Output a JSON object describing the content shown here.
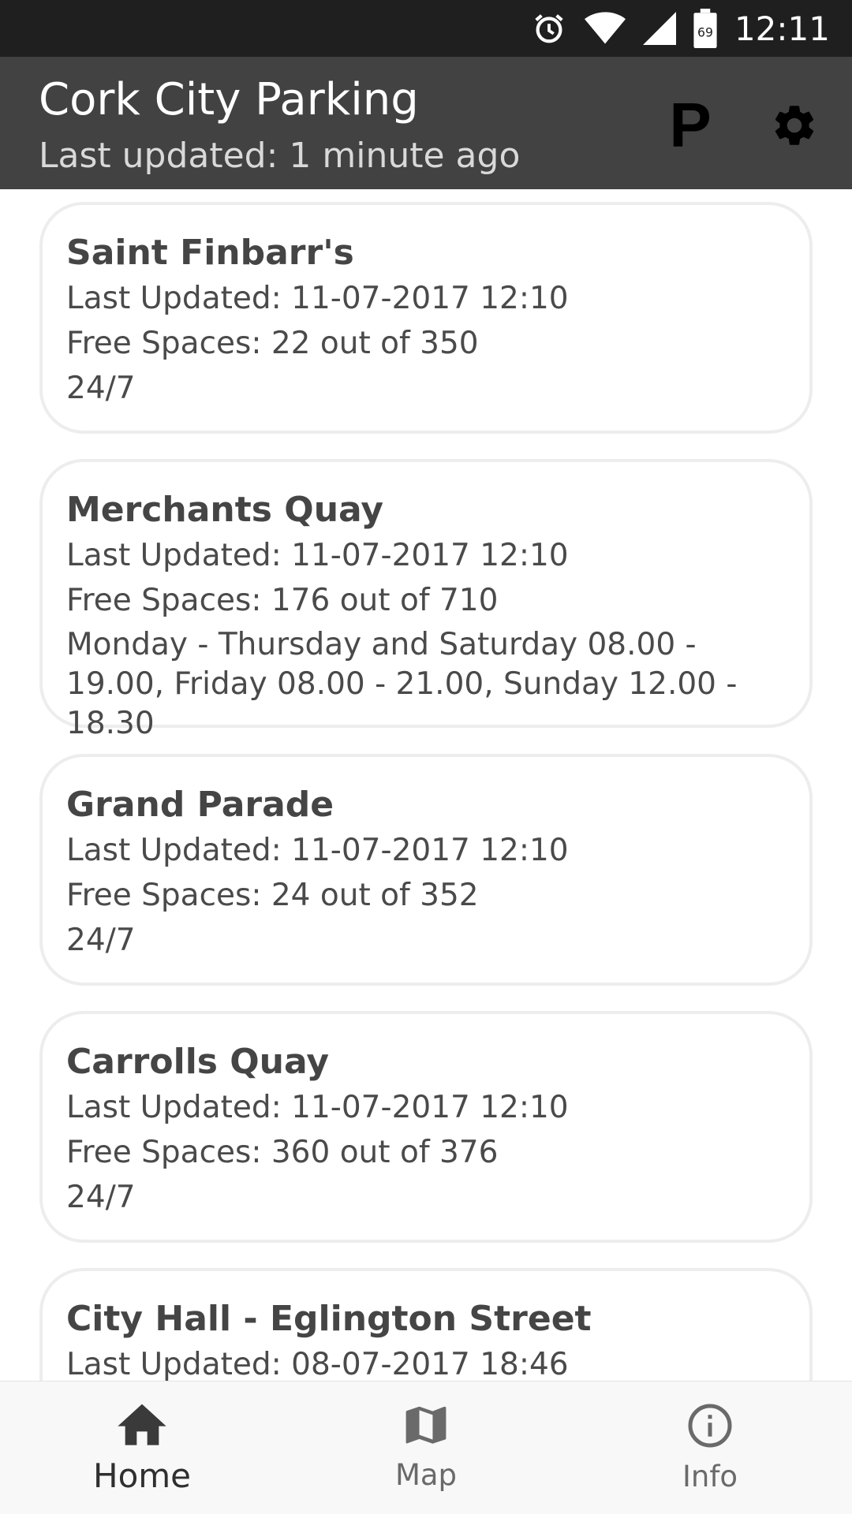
{
  "status_bar": {
    "time": "12:11",
    "battery_level": "69",
    "icons": [
      "alarm-icon",
      "wifi-icon",
      "cell-signal-icon",
      "battery-icon"
    ]
  },
  "app_bar": {
    "title": "Cork City Parking",
    "subtitle": "Last updated: 1 minute ago",
    "parking_label": "P",
    "icons": [
      "parking-icon",
      "gear-icon"
    ]
  },
  "car_parks": [
    {
      "name": "Saint Finbarr's",
      "updated": "Last Updated: 11-07-2017 12:10",
      "spaces": "Free Spaces: 22 out of 350",
      "hours": "24/7"
    },
    {
      "name": "Merchants Quay",
      "updated": "Last Updated: 11-07-2017 12:10",
      "spaces": "Free Spaces: 176 out of 710",
      "hours": "Monday - Thursday and Saturday 08.00 - 19.00, Friday 08.00 - 21.00, Sunday 12.00 - 18.30"
    },
    {
      "name": "Grand Parade",
      "updated": "Last Updated: 11-07-2017 12:10",
      "spaces": "Free Spaces: 24 out of 352",
      "hours": "24/7"
    },
    {
      "name": "Carrolls Quay",
      "updated": "Last Updated: 11-07-2017 12:10",
      "spaces": "Free Spaces: 360 out of 376",
      "hours": "24/7"
    },
    {
      "name": "City Hall - Eglington Street",
      "updated": "Last Updated: 08-07-2017 18:46"
    }
  ],
  "bottom_nav": {
    "items": [
      {
        "label": "Home",
        "icon": "home-icon",
        "active": true
      },
      {
        "label": "Map",
        "icon": "map-icon",
        "active": false
      },
      {
        "label": "Info",
        "icon": "info-icon",
        "active": false
      }
    ]
  }
}
